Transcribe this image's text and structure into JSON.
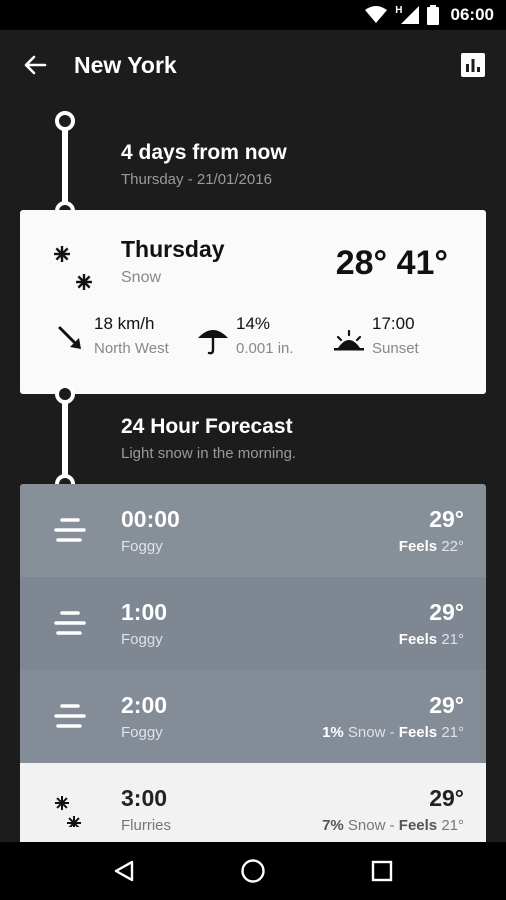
{
  "status_bar": {
    "time": "06:00",
    "network": "H"
  },
  "app_bar": {
    "title": "New York"
  },
  "forecast_header": {
    "title": "4 days from now",
    "date": "Thursday - 21/01/2016"
  },
  "day_card": {
    "day": "Thursday",
    "condition": "Snow",
    "low": "28°",
    "high": "41°",
    "wind": {
      "value": "18 km/h",
      "label": "North West"
    },
    "precip": {
      "value": "14%",
      "label": "0.001 in."
    },
    "sunset": {
      "value": "17:00",
      "label": "Sunset"
    }
  },
  "hourly_header": {
    "title": "24 Hour Forecast",
    "summary": "Light snow in the morning."
  },
  "hours": [
    {
      "time": "00:00",
      "condition": "Foggy",
      "temp": "29°",
      "precip": "",
      "precip_label": "",
      "feels_label": "Feels",
      "feels": "22°"
    },
    {
      "time": "1:00",
      "condition": "Foggy",
      "temp": "29°",
      "precip": "",
      "precip_label": "",
      "feels_label": "Feels",
      "feels": "21°"
    },
    {
      "time": "2:00",
      "condition": "Foggy",
      "temp": "29°",
      "precip": "1%",
      "precip_label": " Snow - ",
      "feels_label": "Feels",
      "feels": "21°"
    },
    {
      "time": "3:00",
      "condition": "Flurries",
      "temp": "29°",
      "precip": "7%",
      "precip_label": " Snow - ",
      "feels_label": "Feels",
      "feels": "21°"
    }
  ],
  "icons": {
    "back": "arrow-left-icon",
    "chart": "bar-chart-icon",
    "snow": "snowflake-icon",
    "wind": "wind-direction-icon",
    "umbrella": "umbrella-icon",
    "sunset": "sunset-icon",
    "fog": "fog-icon"
  }
}
